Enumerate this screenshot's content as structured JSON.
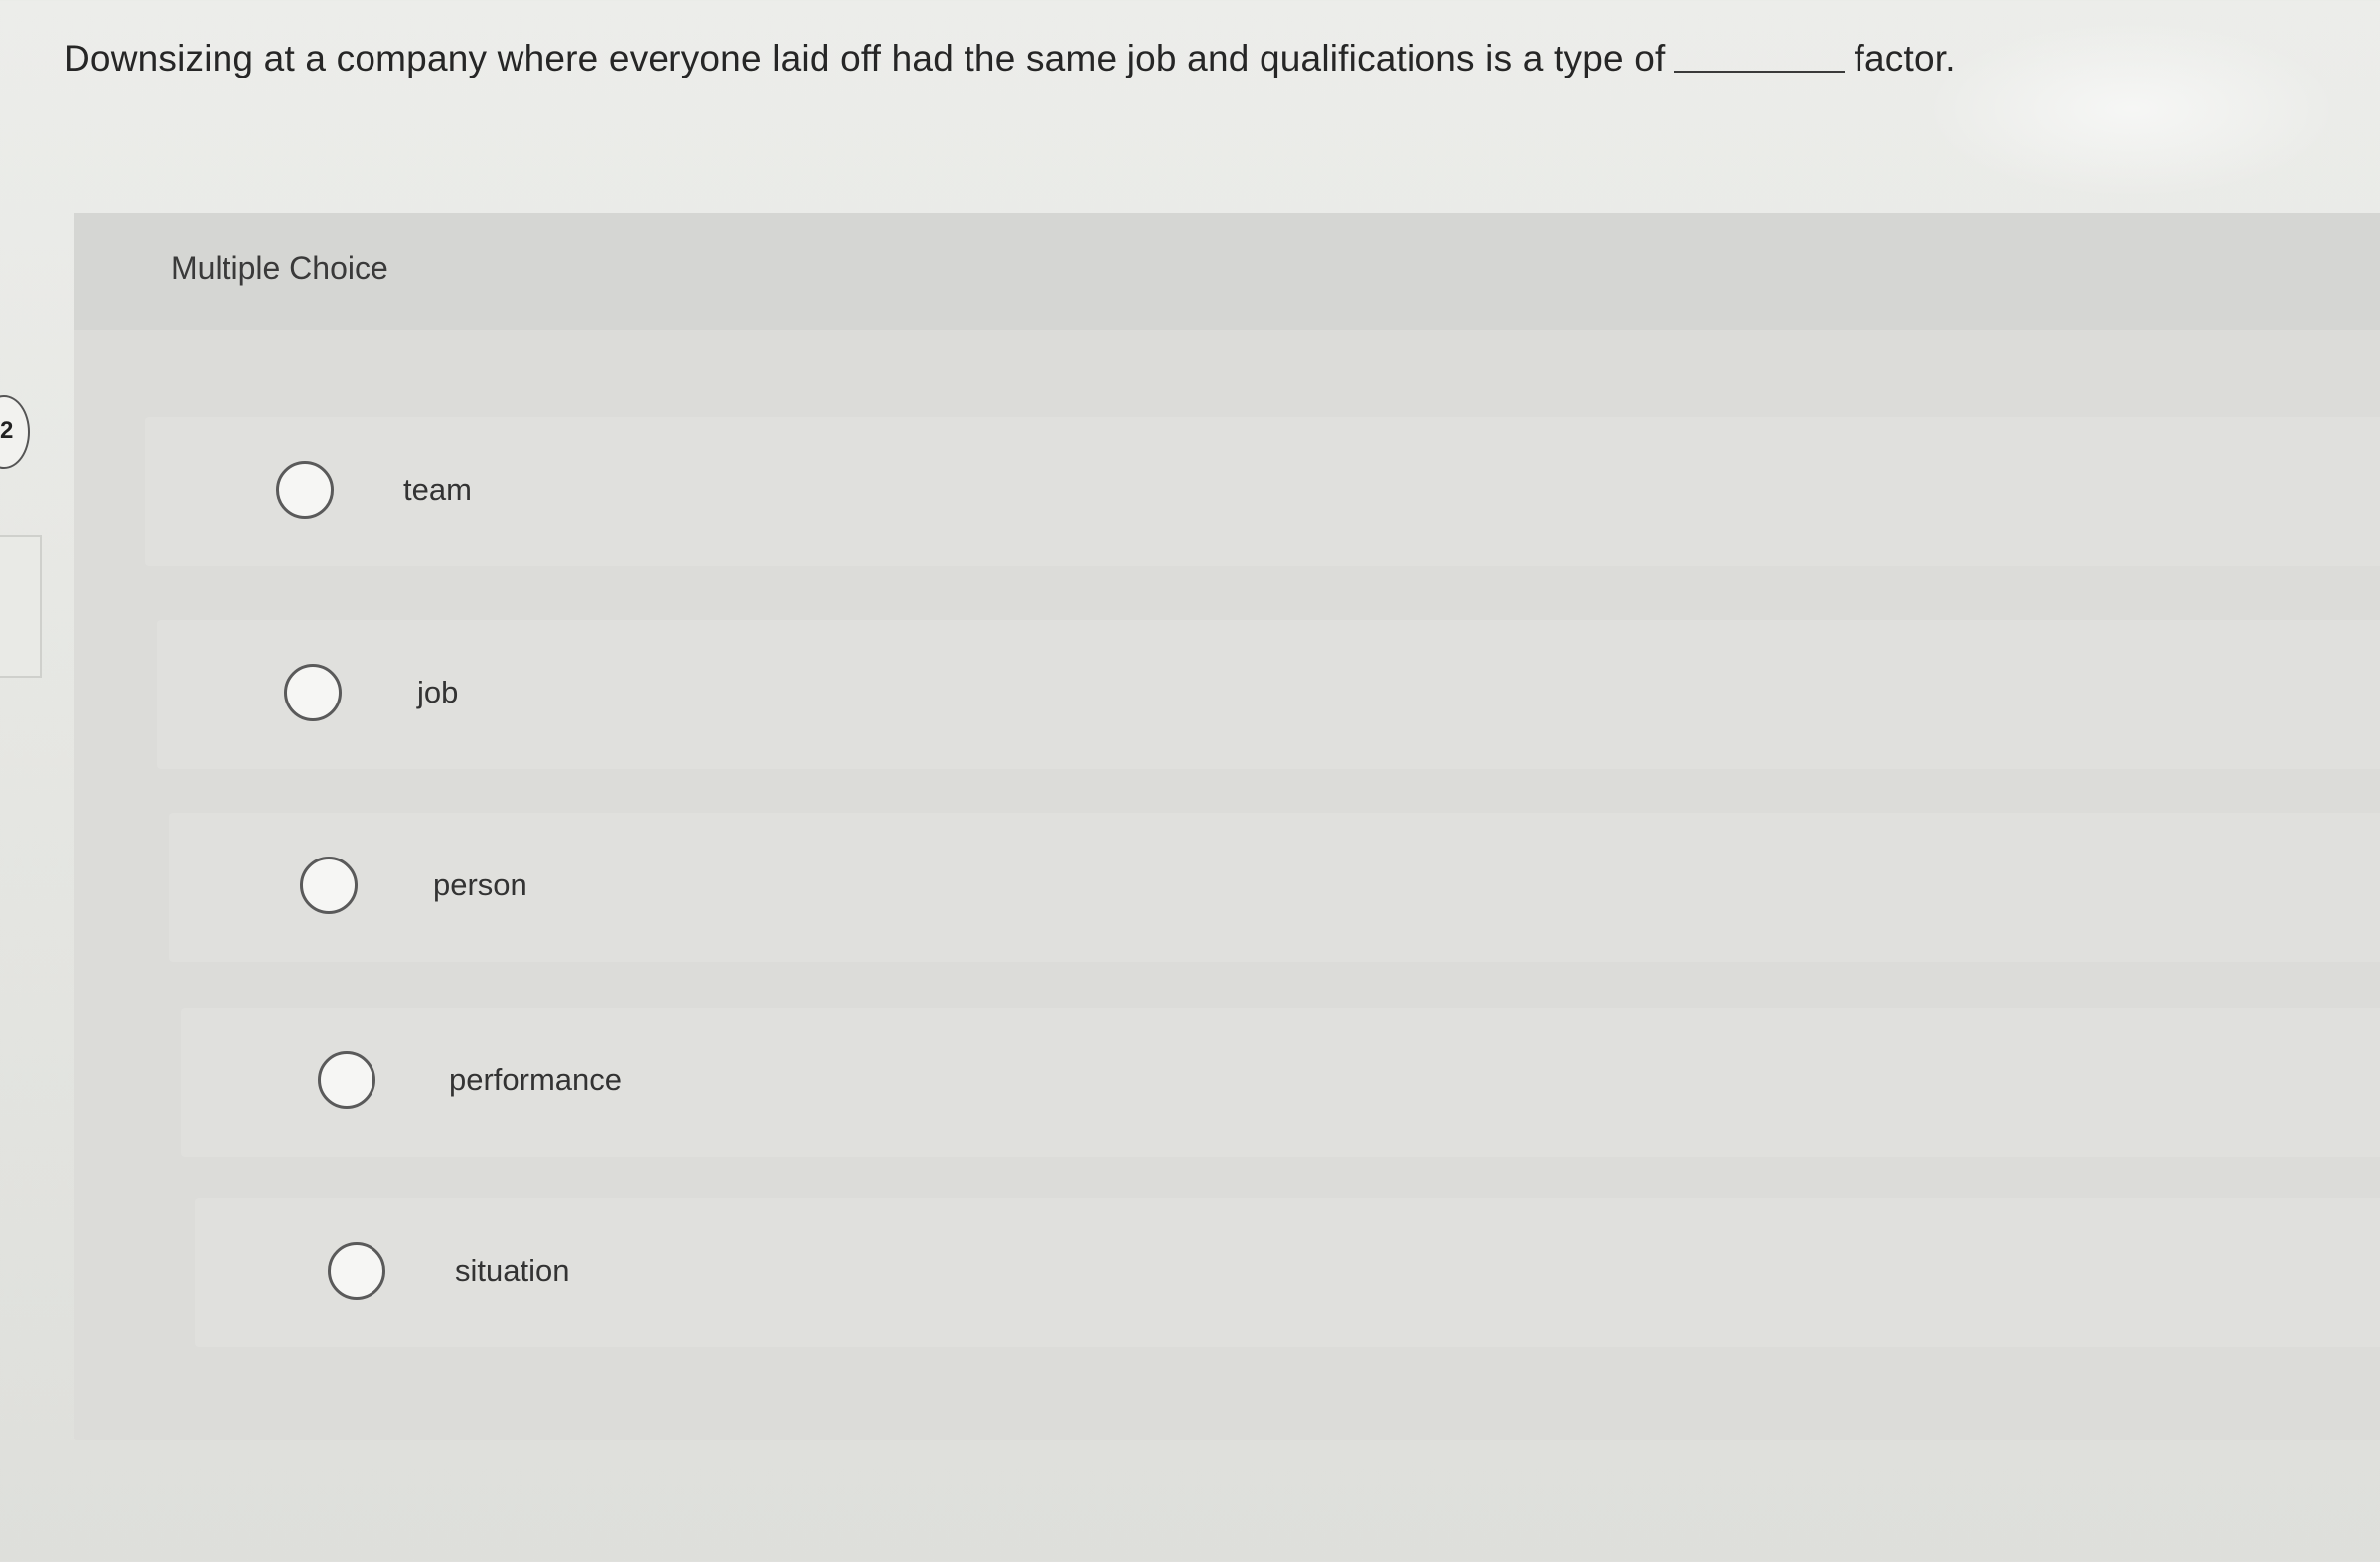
{
  "question": {
    "text_before": "Downsizing at a company where everyone laid off had the same job and qualifications is a type of",
    "text_after": "factor."
  },
  "side_tab": {
    "number": "2"
  },
  "panel": {
    "title": "Multiple Choice"
  },
  "options": [
    {
      "label": "team",
      "selected": false
    },
    {
      "label": "job",
      "selected": false
    },
    {
      "label": "person",
      "selected": false
    },
    {
      "label": "performance",
      "selected": false
    },
    {
      "label": "situation",
      "selected": false
    }
  ]
}
